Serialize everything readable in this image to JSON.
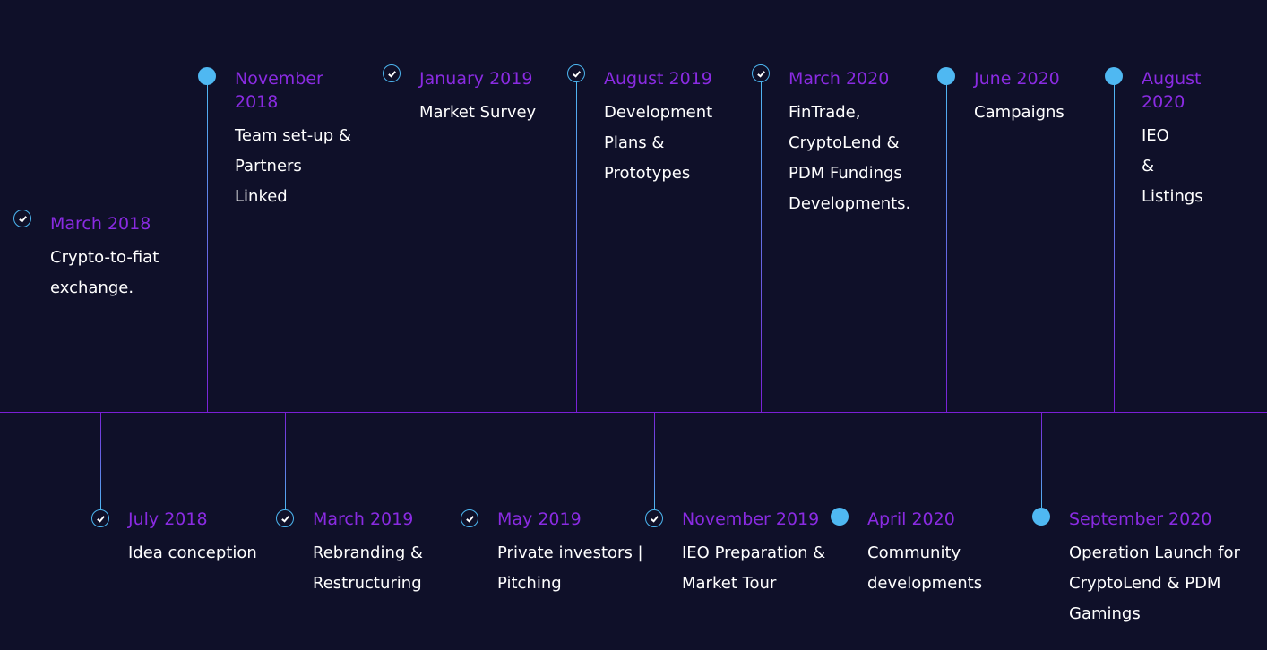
{
  "timeline": {
    "events": [
      {
        "date": "March 2018",
        "desc": "Crypto-to-fiat exchange.",
        "marker": "check-icon"
      },
      {
        "date": "July 2018",
        "desc": "Idea conception",
        "marker": "check-icon"
      },
      {
        "date": "November 2018",
        "desc": "Team set-up & Partners Linked",
        "marker": "dot-icon"
      },
      {
        "date": "March 2019",
        "desc": "Rebranding & Restructuring",
        "marker": "check-icon"
      },
      {
        "date": "January 2019",
        "desc": "Market Survey",
        "marker": "check-icon"
      },
      {
        "date": "May 2019",
        "desc": "Private investors | Pitching",
        "marker": "check-icon"
      },
      {
        "date": "August 2019",
        "desc": "Development Plans & Prototypes",
        "marker": "check-icon"
      },
      {
        "date": "November 2019",
        "desc": "IEO Preparation & Market Tour",
        "marker": "check-icon"
      },
      {
        "date": "March 2020",
        "desc": "FinTrade, CryptoLend & PDM Fundings Developments.",
        "marker": "check-icon"
      },
      {
        "date": "April 2020",
        "desc": "Community developments",
        "marker": "dot-icon"
      },
      {
        "date": "June 2020",
        "desc": "Campaigns",
        "marker": "dot-icon"
      },
      {
        "date": "September 2020",
        "desc": "Operation Launch for CryptoLend & PDM Gamings",
        "marker": "dot-icon"
      },
      {
        "date": "August 2020",
        "desc": "IEO & Listings",
        "marker": "dot-icon"
      }
    ]
  },
  "colors": {
    "background": "#0f1029",
    "date": "#8a2be2",
    "text": "#ffffff",
    "marker": "#4fb8f2",
    "line_purple": "#7a1fd6"
  }
}
